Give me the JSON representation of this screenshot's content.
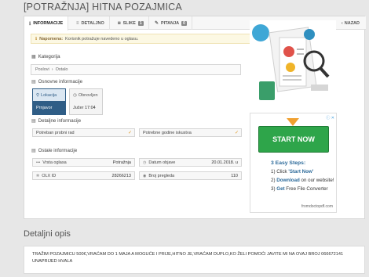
{
  "page_title": "[POTRAŽNJA] HITNA POZAJMICA",
  "tabs": [
    {
      "label": "INFORMACIJE",
      "icon": "info-icon"
    },
    {
      "label": "DETALJNO",
      "icon": "list-icon"
    },
    {
      "label": "SLIKE",
      "icon": "camera-icon",
      "count": "1"
    },
    {
      "label": "PITANJA",
      "icon": "comment-icon",
      "count": "0"
    }
  ],
  "back_label": "NAZAD",
  "notice": {
    "strong": "Napomena:",
    "text": "Korisnik potražuje navedeno u oglasu."
  },
  "category": {
    "label": "Kategorija",
    "path": [
      "Poslovi",
      "Ostalo"
    ]
  },
  "basic": {
    "label": "Osnovne informacije",
    "location": {
      "title": "Lokacija",
      "value": "Prnjavor"
    },
    "renewed": {
      "title": "Obnovljen",
      "value": "Jučer 17:04"
    }
  },
  "details": {
    "label": "Detaljne informacije",
    "fields": [
      "Potreban probni rad",
      "Potrebne godine iskustva"
    ]
  },
  "other": {
    "label": "Ostale informacije",
    "rows": [
      {
        "label": "Vrsta oglasa",
        "value": "Potražnja"
      },
      {
        "label": "Datum objave",
        "value": "20.01.2018. u"
      },
      {
        "label": "OLX ID",
        "value": "28266213"
      },
      {
        "label": "Broj pregleda",
        "value": "110"
      }
    ]
  },
  "ad": {
    "badge": "ⓘ ✕",
    "button": "START NOW",
    "steps_title": "3 Easy Steps:",
    "steps": [
      {
        "n": "1)",
        "pre": "Click ",
        "strong": "'Start Now'",
        "post": ""
      },
      {
        "n": "2)",
        "pre": "",
        "strong": "Download",
        "post": " on our website!"
      },
      {
        "n": "3)",
        "pre": "",
        "strong": "Get",
        "post": " Free File Converter"
      }
    ],
    "source": "fromdoctopdf.com"
  },
  "description": {
    "title": "Detaljni opis",
    "text": "TRAŽIM POZAJMICU 500€,VRAĆAM DO 1 MAJA A MOGUĆE I PRIJE,HITNO JE,VRAĆAM DUPLO,KO ŽELI POMOĆI JAVITE MI NA OVAJ BROJ 066672141 UNAPRIJED HVALA"
  }
}
